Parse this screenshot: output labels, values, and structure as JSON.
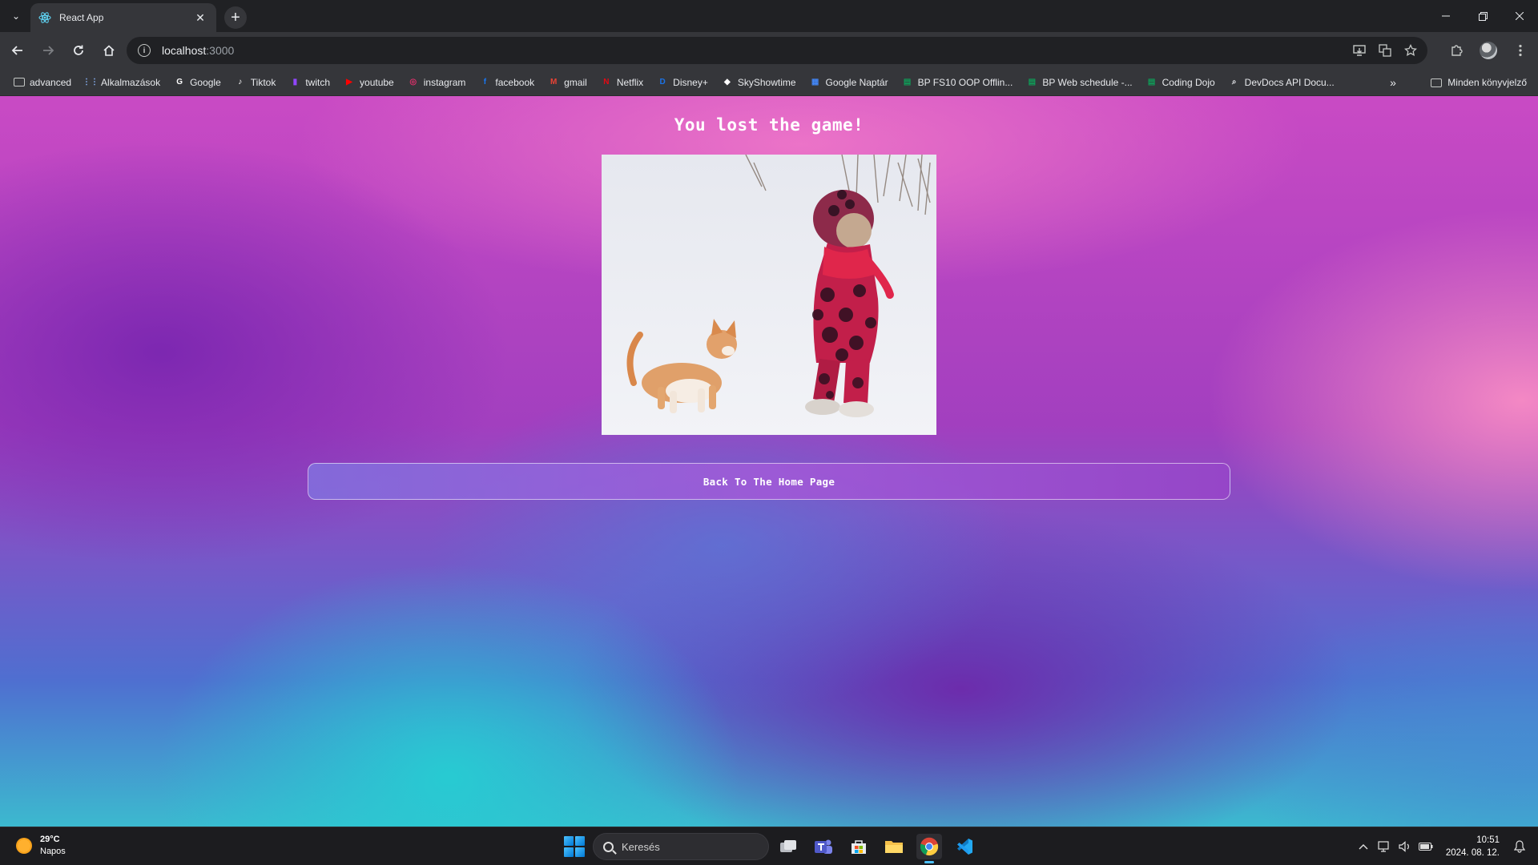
{
  "browser": {
    "tab": {
      "title": "React App",
      "close_glyph": "✕"
    },
    "new_tab_glyph": "+",
    "address": {
      "host": "localhost",
      "port": ":3000"
    }
  },
  "bookmarks": [
    {
      "label": "advanced",
      "icon": "folder-icon",
      "color": "#c4c7c5"
    },
    {
      "label": "Alkalmazások",
      "icon": "apps-grid-icon",
      "color": "#8ab4f8"
    },
    {
      "label": "Google",
      "icon": "google-icon",
      "color": "#ffffff"
    },
    {
      "label": "Tiktok",
      "icon": "tiktok-icon",
      "color": "#ffffff"
    },
    {
      "label": "twitch",
      "icon": "twitch-icon",
      "color": "#9146ff"
    },
    {
      "label": "youtube",
      "icon": "youtube-icon",
      "color": "#ff0000"
    },
    {
      "label": "instagram",
      "icon": "instagram-icon",
      "color": "#e1306c"
    },
    {
      "label": "facebook",
      "icon": "facebook-icon",
      "color": "#1877f2"
    },
    {
      "label": "gmail",
      "icon": "gmail-icon",
      "color": "#ea4335"
    },
    {
      "label": "Netflix",
      "icon": "netflix-icon",
      "color": "#e50914"
    },
    {
      "label": "Disney+",
      "icon": "disney-icon",
      "color": "#1a73e8"
    },
    {
      "label": "SkyShowtime",
      "icon": "skyshowtime-icon",
      "color": "#ffffff"
    },
    {
      "label": "Google Naptár",
      "icon": "calendar-icon",
      "color": "#4285f4"
    },
    {
      "label": "BP FS10 OOP Offlin...",
      "icon": "sheets-icon",
      "color": "#0f9d58"
    },
    {
      "label": "BP Web schedule -...",
      "icon": "sheets-icon",
      "color": "#0f9d58"
    },
    {
      "label": "Coding Dojo",
      "icon": "sheets-icon",
      "color": "#0f9d58"
    },
    {
      "label": "DevDocs API Docu...",
      "icon": "devdocs-icon",
      "color": "#e8eaed"
    }
  ],
  "bookmarks_more_glyph": "»",
  "bookmarks_all": "Minden könyvjelző",
  "page": {
    "title": "You lost the game!",
    "home_button": "Back To The Home Page"
  },
  "taskbar": {
    "weather_temp": "29°C",
    "weather_desc": "Napos",
    "search_placeholder": "Keresés",
    "time": "10:51",
    "date": "2024. 08. 12."
  }
}
